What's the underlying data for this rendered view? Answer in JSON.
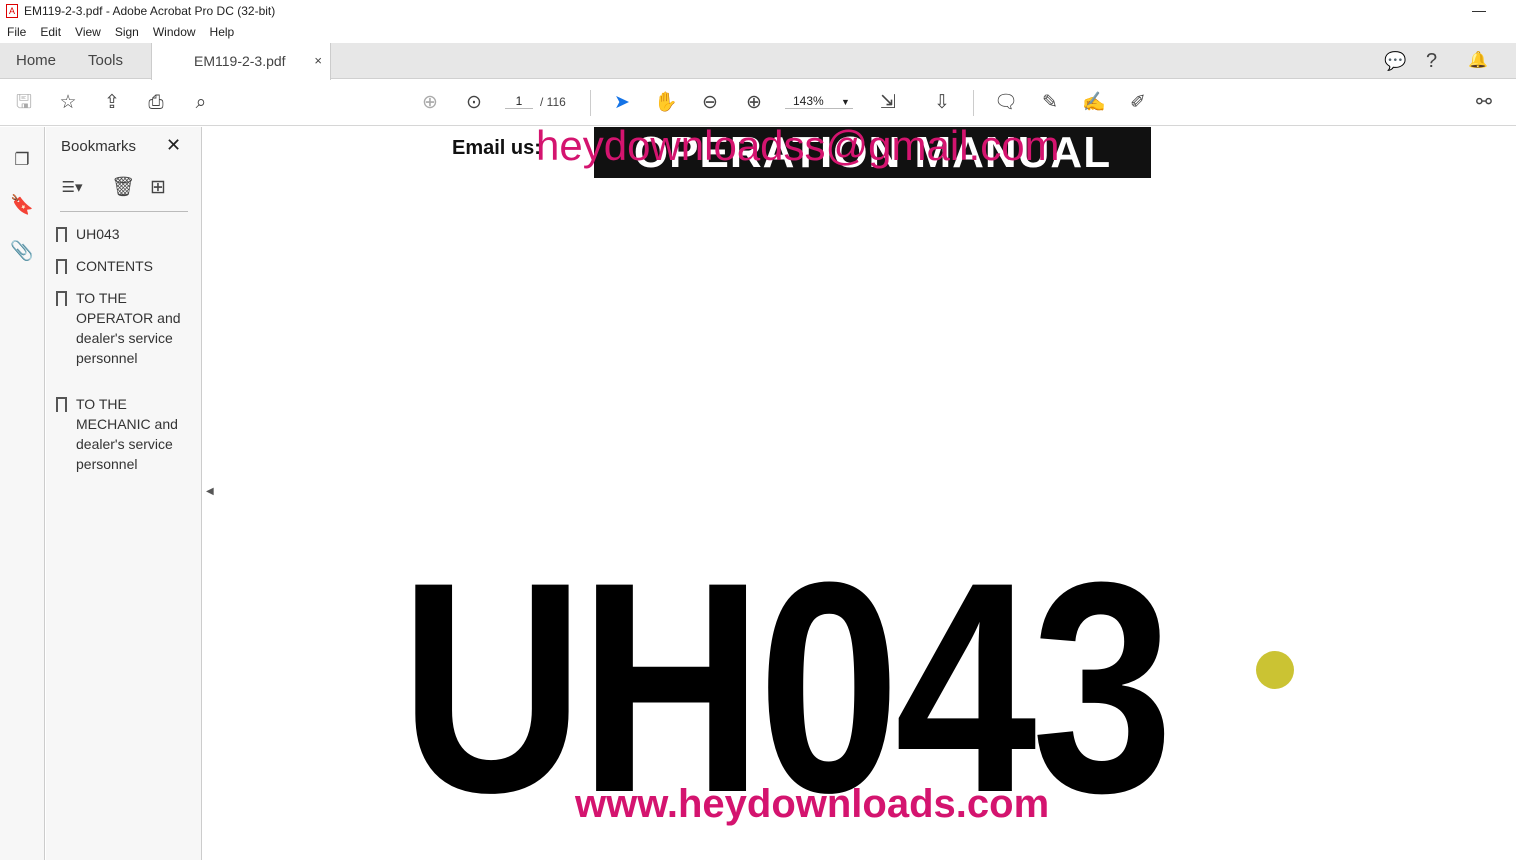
{
  "window": {
    "title": "EM119-2-3.pdf - Adobe Acrobat Pro DC (32-bit)",
    "minimize": "—"
  },
  "menu": [
    "File",
    "Edit",
    "View",
    "Sign",
    "Window",
    "Help"
  ],
  "tabs": {
    "home": "Home",
    "tools": "Tools",
    "document": "EM119-2-3.pdf",
    "close": "×"
  },
  "toolbar": {
    "page_current": "1",
    "page_total": "/ 116",
    "zoom": "143%"
  },
  "bookmarks": {
    "title": "Bookmarks",
    "close": "✕",
    "items": [
      "UH043",
      "CONTENTS",
      "TO THE OPERATOR and dealer's service personnel",
      "TO THE MECHANIC and dealer's service personnel"
    ]
  },
  "document": {
    "banner": "OPERATION MANUAL",
    "email_label": "Email us:",
    "email": "heydownloadss@gmail.com",
    "model": "UH043",
    "url": "www.heydownloads.com"
  }
}
